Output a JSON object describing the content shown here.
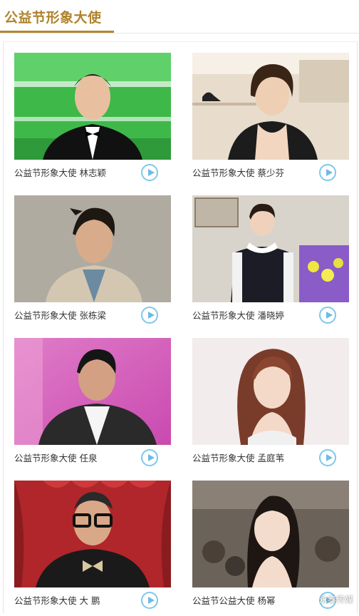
{
  "header": {
    "title": "公益节形象大使"
  },
  "accent_color": "#b6862c",
  "play_icon_color": "#6dbbe2",
  "cards": [
    {
      "caption": "公益节形象大使 林志颖"
    },
    {
      "caption": "公益节形象大使 蔡少芬"
    },
    {
      "caption": "公益节形象大使 张栋梁"
    },
    {
      "caption": "公益节形象大使 潘晓婷"
    },
    {
      "caption": "公益节形象大使 任泉"
    },
    {
      "caption": "公益节形象大使 孟庭苇"
    },
    {
      "caption": "公益节形象大使 大 鹏"
    },
    {
      "caption": "公益节公益大使 杨幂"
    }
  ],
  "watermark": {
    "text": "永泰传媒"
  }
}
